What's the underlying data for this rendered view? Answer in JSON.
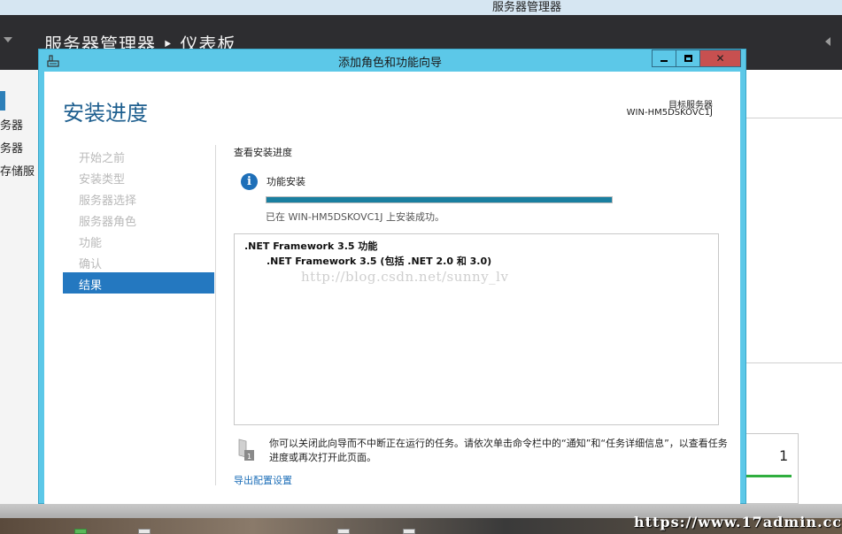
{
  "window": {
    "title": "服务器管理器",
    "breadcrumb": "服务器管理器 ‣ 仪表板"
  },
  "sidebar": {
    "items": [
      {
        "label": "务器"
      },
      {
        "label": "务器"
      },
      {
        "label": "存储服"
      }
    ]
  },
  "tile": {
    "count": "1"
  },
  "dialog": {
    "title": "添加角色和功能向导",
    "heading": "安装进度",
    "target_label": "目标服务器",
    "target_server": "WIN-HM5DSKOVC1J",
    "steps": [
      {
        "label": "开始之前",
        "state": "disabled"
      },
      {
        "label": "安装类型",
        "state": "disabled"
      },
      {
        "label": "服务器选择",
        "state": "disabled"
      },
      {
        "label": "服务器角色",
        "state": "disabled"
      },
      {
        "label": "功能",
        "state": "disabled"
      },
      {
        "label": "确认",
        "state": "disabled"
      },
      {
        "label": "结果",
        "state": "active"
      }
    ],
    "view_progress": "查看安装进度",
    "install_label": "功能安装",
    "progress_fraction": 1.0,
    "success_text": "已在 WIN-HM5DSKOVC1J 上安装成功。",
    "features": [
      ".NET Framework 3.5 功能",
      ".NET Framework 3.5 (包括 .NET 2.0 和 3.0)"
    ],
    "blog_watermark": "http://blog.csdn.net/sunny_lv",
    "note": "你可以关闭此向导而不中断正在运行的任务。请依次单击命令栏中的“通知”和“任务详细信息”，以查看任务进度或再次打开此页面。",
    "export_link": "导出配置设置",
    "flag_badge": "1"
  },
  "watermark": "https://www.17admin.cc",
  "colors": {
    "accent": "#2478c0",
    "dialog_frame": "#5cc8e8",
    "progress": "#1a7fa0",
    "close_button": "#c75050"
  }
}
